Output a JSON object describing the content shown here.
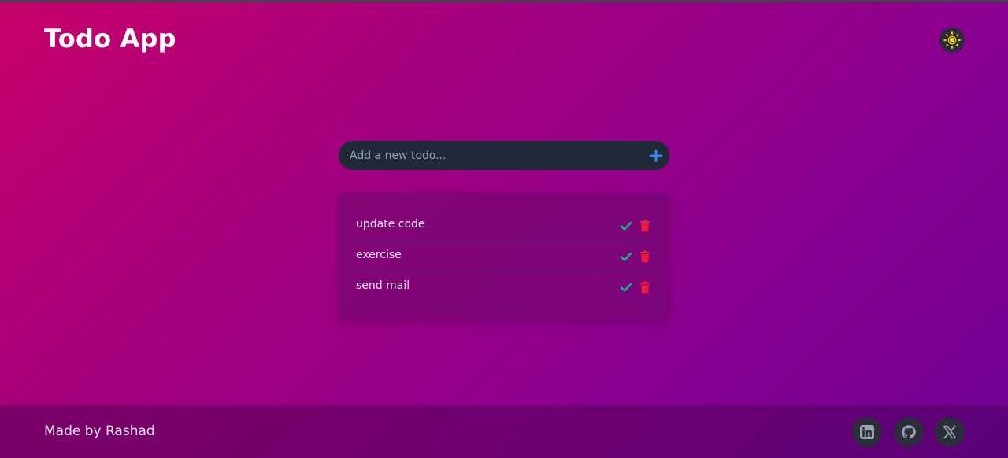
{
  "app": {
    "title": "Todo App"
  },
  "header": {
    "theme_toggle_icon": "sun-icon"
  },
  "add_todo": {
    "placeholder": "Add a new todo...",
    "value": "",
    "add_icon": "plus-icon"
  },
  "todos": [
    {
      "text": "update code",
      "complete_icon": "check-icon",
      "delete_icon": "trash-icon"
    },
    {
      "text": "exercise",
      "complete_icon": "check-icon",
      "delete_icon": "trash-icon"
    },
    {
      "text": "send mail",
      "complete_icon": "check-icon",
      "delete_icon": "trash-icon"
    }
  ],
  "footer": {
    "credit": "Made by Rashad",
    "social_icons": [
      "linkedin-icon",
      "github-icon",
      "x-icon"
    ]
  },
  "colors": {
    "accent_add": "#3b82f6",
    "check": "#10b981",
    "delete": "#ef1d3a",
    "sun": "#f5e000",
    "input_bg": "#1f2937"
  }
}
